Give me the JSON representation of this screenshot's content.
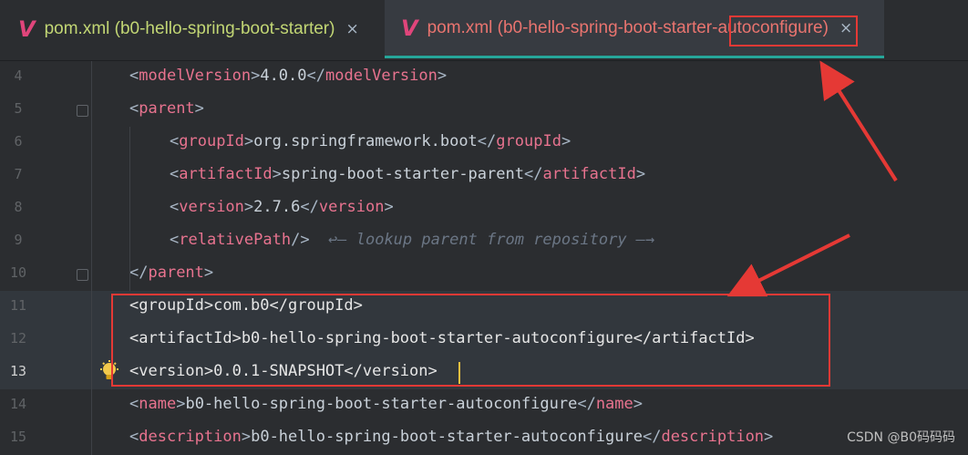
{
  "tabs": [
    {
      "icon": "vue-icon",
      "title": "pom.xml (b0-hello-spring-boot-starter)",
      "active": false,
      "title_color": "#c2d674"
    },
    {
      "icon": "vue-icon",
      "title": "pom.xml (b0-hello-spring-boot-starter-autoconfigure)",
      "active": true,
      "title_color": "#e9746f"
    }
  ],
  "close_glyph": "×",
  "lines": [
    {
      "num": "4",
      "open": "modelVersion",
      "value": "4.0.0",
      "close": "modelVersion"
    },
    {
      "num": "5",
      "open": "parent"
    },
    {
      "num": "6",
      "open": "groupId",
      "value": "org.springframework.boot",
      "close": "groupId"
    },
    {
      "num": "7",
      "open": "artifactId",
      "value": "spring-boot-starter-parent",
      "close": "artifactId"
    },
    {
      "num": "8",
      "open": "version",
      "value": "2.7.6",
      "close": "version"
    },
    {
      "num": "9",
      "selfclose": "relativePath",
      "comment": "↩— lookup parent from repository —→"
    },
    {
      "num": "10",
      "closeonly": "parent"
    },
    {
      "num": "11",
      "plain": "<groupId>com.b0</groupId>"
    },
    {
      "num": "12",
      "plain": "<artifactId>b0-hello-spring-boot-starter-autoconfigure</artifactId>"
    },
    {
      "num": "13",
      "plain": "<version>0.0.1-SNAPSHOT</version>"
    },
    {
      "num": "14",
      "open": "name",
      "value": "b0-hello-spring-boot-starter-autoconfigure",
      "close": "name"
    },
    {
      "num": "15",
      "open": "description",
      "value": "b0-hello-spring-boot-starter-autoconfigure",
      "close": "description"
    }
  ],
  "watermark": "CSDN @B0码码码",
  "colors": {
    "annotation": "#e53935",
    "accent": "#26a69a",
    "tag": "#e8738f"
  }
}
